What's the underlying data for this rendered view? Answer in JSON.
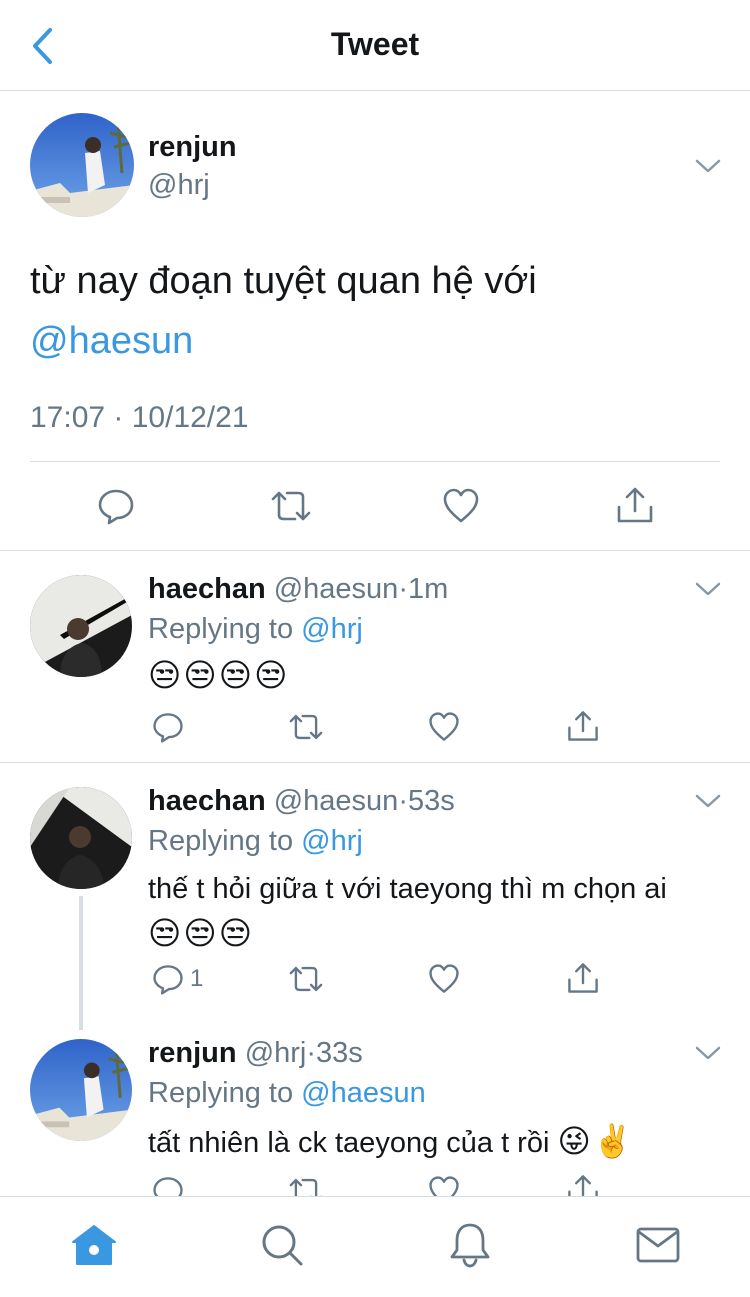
{
  "header": {
    "title": "Tweet"
  },
  "main_tweet": {
    "name": "renjun",
    "handle": "@hrj",
    "text": "từ nay đoạn tuyệt quan hệ với",
    "mention": "@haesun",
    "timestamp": "17:07 · 10/12/21"
  },
  "replies": [
    {
      "name": "haechan",
      "handle": "@haesun",
      "time": "1m",
      "replying_prefix": "Replying to ",
      "replying_to": "@hrj",
      "text": "",
      "emojis": "😒😒😒😒",
      "reply_count": ""
    },
    {
      "name": "haechan",
      "handle": "@haesun",
      "time": "53s",
      "replying_prefix": "Replying to ",
      "replying_to": "@hrj",
      "text": "thế t hỏi giữa t với taeyong thì m chọn ai",
      "emojis": "😒😒😒",
      "reply_count": "1"
    },
    {
      "name": "renjun",
      "handle": "@hrj",
      "time": "33s",
      "replying_prefix": "Replying to ",
      "replying_to": "@haesun",
      "text": "tất nhiên là ck taeyong của t rồi",
      "emojis": "😜✌️",
      "reply_count": ""
    }
  ],
  "separator": "·",
  "colors": {
    "accent": "#3a98e0",
    "muted": "#657786",
    "divider": "#d8dde1",
    "tab_active": "#3a98e0",
    "tab_inactive": "#657786"
  },
  "tabs": [
    {
      "icon": "home-icon",
      "active": true
    },
    {
      "icon": "search-icon",
      "active": false
    },
    {
      "icon": "bell-icon",
      "active": false
    },
    {
      "icon": "mail-icon",
      "active": false
    }
  ]
}
